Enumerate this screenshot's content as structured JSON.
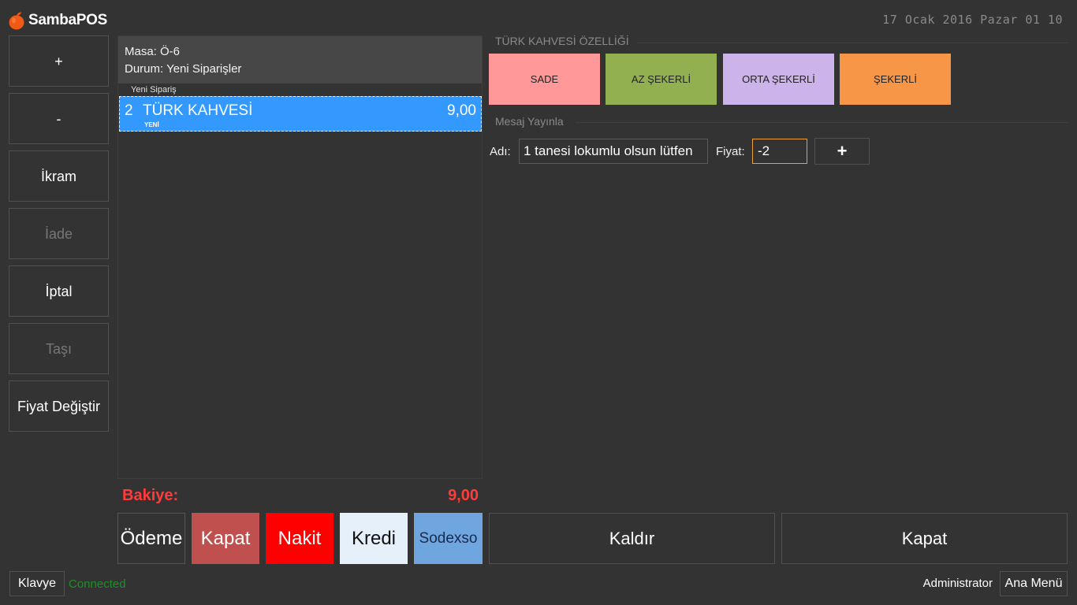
{
  "app": {
    "brand": "SambaPOS",
    "datetime": "17 Ocak 2016 Pazar 01 10"
  },
  "side_buttons": [
    {
      "label": "+",
      "enabled": true
    },
    {
      "label": "-",
      "enabled": true
    },
    {
      "label": "İkram",
      "enabled": true
    },
    {
      "label": "İade",
      "enabled": false
    },
    {
      "label": "İptal",
      "enabled": true
    },
    {
      "label": "Taşı",
      "enabled": false
    },
    {
      "label": "Fiyat Değiştir",
      "enabled": true
    }
  ],
  "ticket": {
    "table": "Masa: Ö-6",
    "status": "Durum: Yeni Siparişler",
    "group": "Yeni Sipariş",
    "order": {
      "qty": "2",
      "name": "TÜRK KAHVESİ",
      "price": "9,00",
      "tag": "YENİ"
    },
    "balance_label": "Bakiye:",
    "balance_value": "9,00"
  },
  "payment": {
    "odeme": "Ödeme",
    "kapat": "Kapat",
    "nakit": "Nakit",
    "kredi": "Kredi",
    "sodexso": "Sodexso",
    "kaldir": "Kaldır",
    "kapat_big": "Kapat"
  },
  "properties": {
    "title": "TÜRK KAHVESİ ÖZELLİĞİ",
    "items": [
      {
        "label": "SADE",
        "color": "#ff9999"
      },
      {
        "label": "AZ ŞEKERLİ",
        "color": "#92b050"
      },
      {
        "label": "ORTA ŞEKERLİ",
        "color": "#ccb3ea"
      },
      {
        "label": "ŞEKERLİ",
        "color": "#f79646"
      }
    ]
  },
  "broadcast": {
    "title": "Mesaj Yayınla",
    "name_label": "Adı:",
    "name_value": "1 tanesi lokumlu olsun lütfen",
    "price_label": "Fiyat:",
    "price_value": "-2",
    "add_label": "+"
  },
  "footer": {
    "keyboard": "Klavye",
    "status": "Connected",
    "user": "Administrator",
    "main_menu": "Ana Menü"
  },
  "colors": {
    "background": "#333333",
    "selected_row": "#3399ff",
    "balance": "#ff3b3b",
    "connected": "#1f8f2a",
    "kapat": "#c0504d",
    "nakit": "#ff0000",
    "kredi": "#e6f0fb",
    "sodexso": "#6fa6e0"
  }
}
